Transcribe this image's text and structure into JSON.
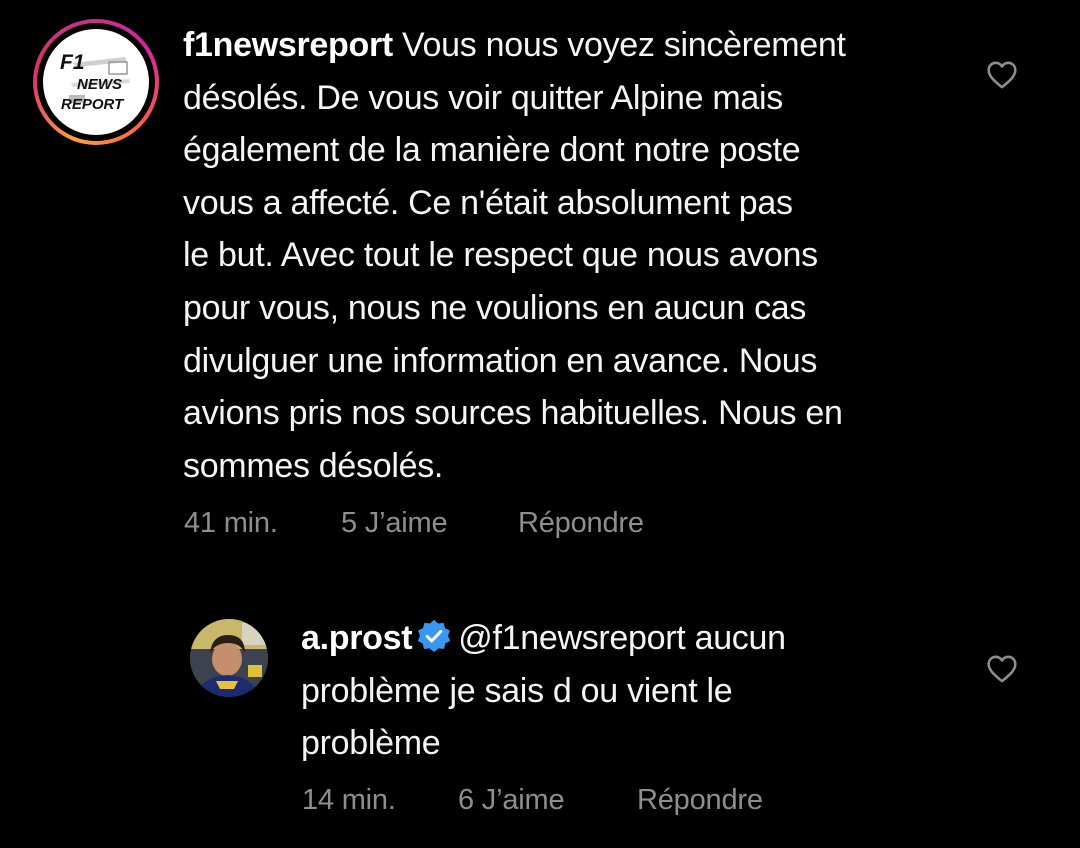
{
  "comments": [
    {
      "username": "f1newsreport",
      "text": " Vous nous voyez sincèrement\ndésolés. De vous voir quitter Alpine mais\négalement de la manière dont notre poste\nvous a affecté. Ce n'était absolument pas\nle but. Avec tout le respect que nous avons\npour vous, nous ne voulions en aucun cas\ndivulguer une information en avance. Nous\navions pris nos sources habituelles. Nous en\nsommes désolés.",
      "time": "41 min.",
      "likes": "5 J’aime",
      "reply": "Répondre",
      "avatar_logo_lines": [
        "F1",
        "NEWS",
        "REPORT"
      ]
    },
    {
      "username": "a.prost",
      "verified": true,
      "mention": "@f1newsreport",
      "text": " aucun\nproblème je sais d ou vient le\nproblème",
      "time": "14 min.",
      "likes": "6 J’aime",
      "reply": "Répondre"
    }
  ],
  "icons": {
    "like": "heart-outline-icon",
    "verified": "verified-badge-icon"
  },
  "colors": {
    "background": "#000000",
    "text": "#f5f5f5",
    "meta": "#8e8e8e",
    "verified": "#3897f0",
    "story_ring_start": "#f9a33c",
    "story_ring_end": "#c13584"
  }
}
